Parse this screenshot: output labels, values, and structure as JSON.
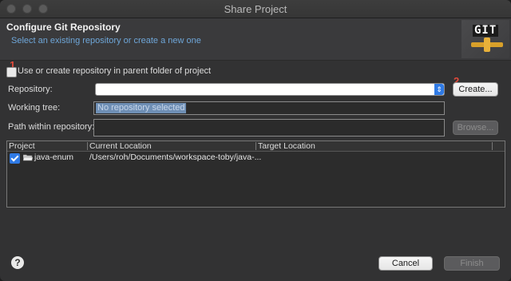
{
  "window": {
    "title": "Share Project"
  },
  "header": {
    "title": "Configure Git Repository",
    "subtitle": "Select an existing repository or create a new one",
    "logo_text": "GIT"
  },
  "annotations": {
    "one": "1",
    "two": "2"
  },
  "use_parent": {
    "label": "Use or create repository in parent folder of project",
    "checked": false
  },
  "repository": {
    "label": "Repository:",
    "value": ""
  },
  "create_button": "Create...",
  "working_tree": {
    "label": "Working tree:",
    "value": "No repository selected"
  },
  "path_within": {
    "label": "Path within repository:",
    "value": ""
  },
  "browse_button": "Browse...",
  "table": {
    "headers": [
      "Project",
      "Current Location",
      "Target Location"
    ],
    "rows": [
      {
        "checked": true,
        "project": "java-enum",
        "current": "/Users/roh/Documents/workspace-toby/java-...",
        "target": ""
      }
    ]
  },
  "footer": {
    "help": "?",
    "cancel": "Cancel",
    "finish": "Finish"
  }
}
